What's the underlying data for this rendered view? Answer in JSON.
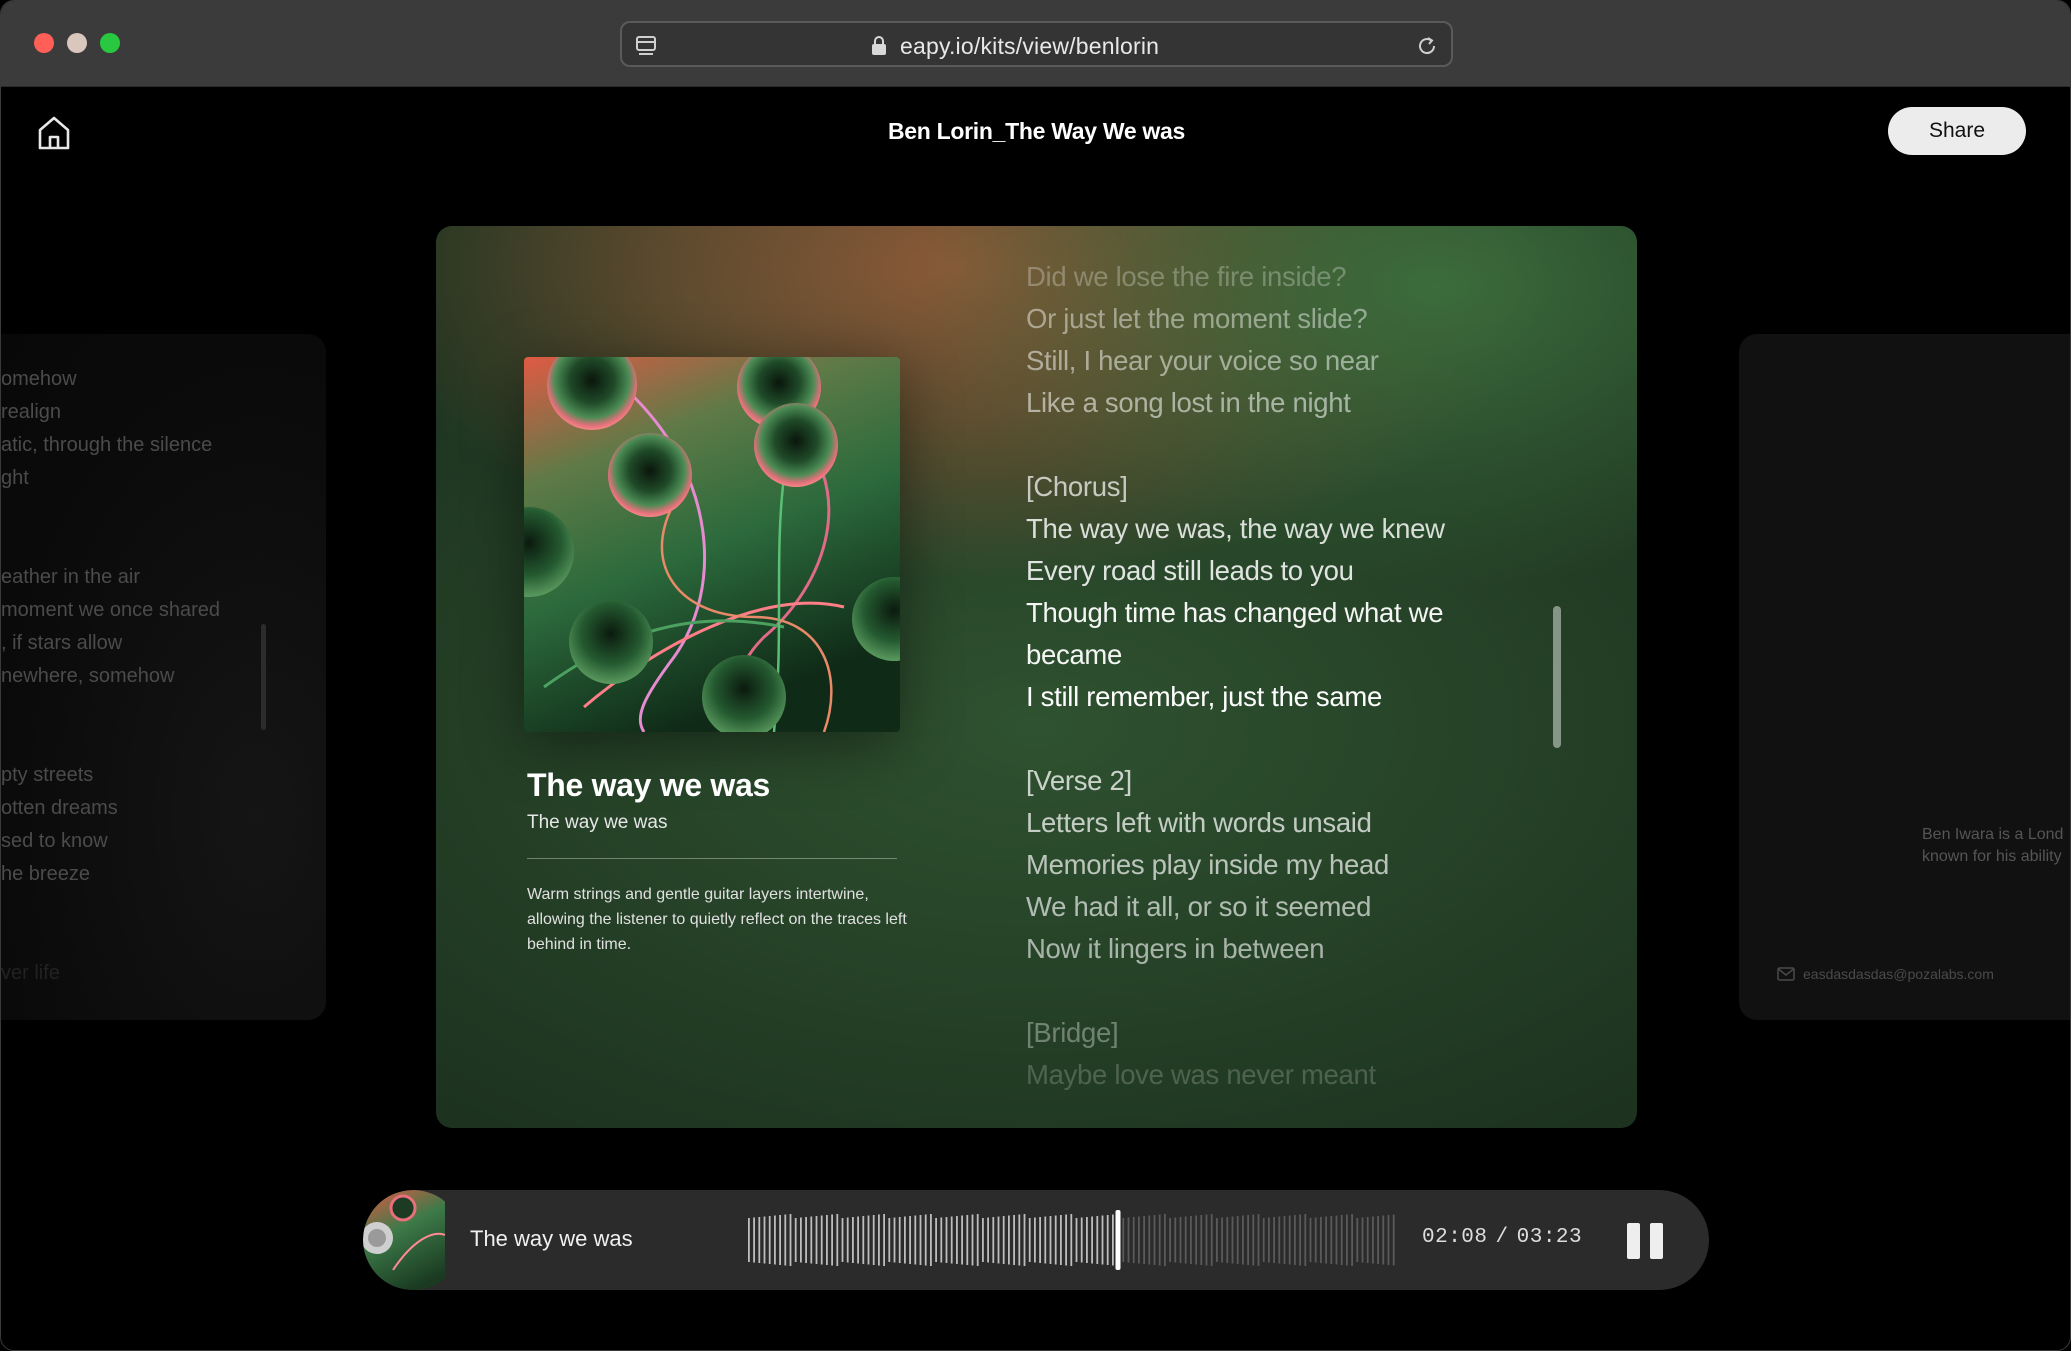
{
  "browser": {
    "url": "eapy.io/kits/view/benlorin"
  },
  "header": {
    "title": "Ben Lorin_The Way We was",
    "share_label": "Share"
  },
  "left_card": {
    "lines": [
      "omehow",
      "realign",
      "atic, through the silence",
      "ght",
      "eather in the air",
      "moment we once shared",
      ", if stars allow",
      "newhere, somehow",
      "pty streets",
      "otten dreams",
      "sed to know",
      "he breeze",
      "ver life"
    ]
  },
  "right_card": {
    "bio_line1": "Ben Iwara is a Lond",
    "bio_line2": "known for his ability",
    "email": "easdasdasdas@pozalabs.com"
  },
  "song": {
    "title": "The way we was",
    "subtitle": "The way we was",
    "description": "Warm strings and gentle guitar layers intertwine, allowing the listener to quietly reflect on the traces left behind in time."
  },
  "lyrics": [
    {
      "text": "Did we lose the fire inside?",
      "opacity": 0.28
    },
    {
      "text": "Or just let the moment slide?",
      "opacity": 0.45
    },
    {
      "text": "Still, I hear your voice so near",
      "opacity": 0.5
    },
    {
      "text": "Like a song lost in the night",
      "opacity": 0.55
    },
    {
      "text": "",
      "gap": true
    },
    {
      "text": "[Chorus]",
      "opacity": 0.7
    },
    {
      "text": "The way we was, the way we knew",
      "opacity": 0.82
    },
    {
      "text": "Every road still leads to you",
      "opacity": 0.86
    },
    {
      "text": "Though time has changed what we",
      "opacity": 0.95
    },
    {
      "text": "became",
      "opacity": 0.95
    },
    {
      "text": "I still remember, just the same",
      "opacity": 1
    },
    {
      "text": "",
      "gap": true
    },
    {
      "text": "[Verse 2]",
      "opacity": 0.75
    },
    {
      "text": "Letters left with words unsaid",
      "opacity": 0.72
    },
    {
      "text": "Memories play inside my head",
      "opacity": 0.68
    },
    {
      "text": "We had it all, or so it seemed",
      "opacity": 0.64
    },
    {
      "text": "Now it lingers in between",
      "opacity": 0.6
    },
    {
      "text": "",
      "gap": true
    },
    {
      "text": "[Bridge]",
      "opacity": 0.35
    },
    {
      "text": "Maybe love was never meant",
      "opacity": 0.2
    }
  ],
  "player": {
    "title": "The way we was",
    "current_time": "02:08",
    "separator": "/",
    "total_time": "03:23",
    "progress": 0.57
  },
  "colors": {
    "accent_bg": "#2b2b2b",
    "share_bg": "#ececec"
  }
}
